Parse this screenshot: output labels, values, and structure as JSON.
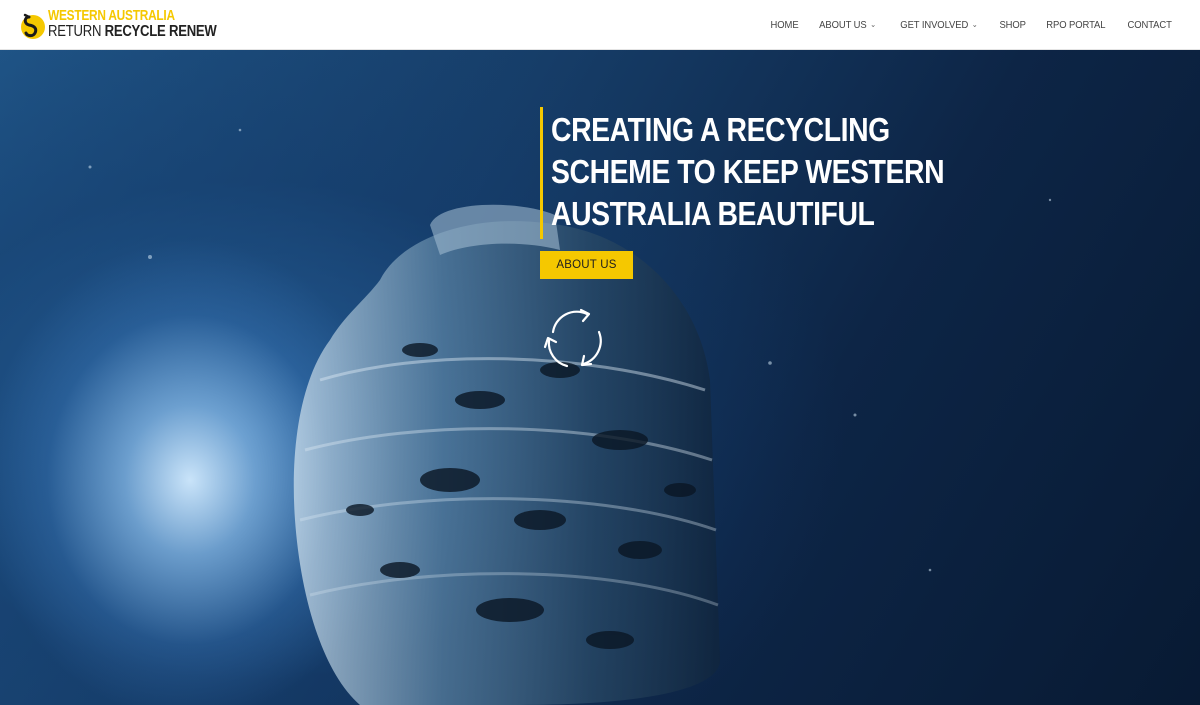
{
  "header": {
    "logo": {
      "line1": "WESTERN AUSTRALIA",
      "line2_regular": "RETURN ",
      "line2_bold": "RECYCLE RENEW"
    },
    "nav": [
      {
        "label": "HOME",
        "dropdown": false
      },
      {
        "label": "ABOUT US",
        "dropdown": true
      },
      {
        "label": "GET INVOLVED",
        "dropdown": true
      },
      {
        "label": "SHOP",
        "dropdown": false
      },
      {
        "label": "RPO PORTAL",
        "dropdown": false
      },
      {
        "label": "CONTACT",
        "dropdown": false
      }
    ]
  },
  "hero": {
    "headline": "CREATING A RECYCLING SCHEME TO KEEP WESTERN AUSTRALIA BEAUTIFUL",
    "button_label": "ABOUT US"
  },
  "colors": {
    "accent": "#f5c800",
    "header_bg": "#ffffff",
    "hero_dark": "#0b1d33"
  },
  "icons": {
    "logo": "swan-icon",
    "chevron": "chevron-down-icon",
    "hero": "recycle-arrows-icon"
  }
}
